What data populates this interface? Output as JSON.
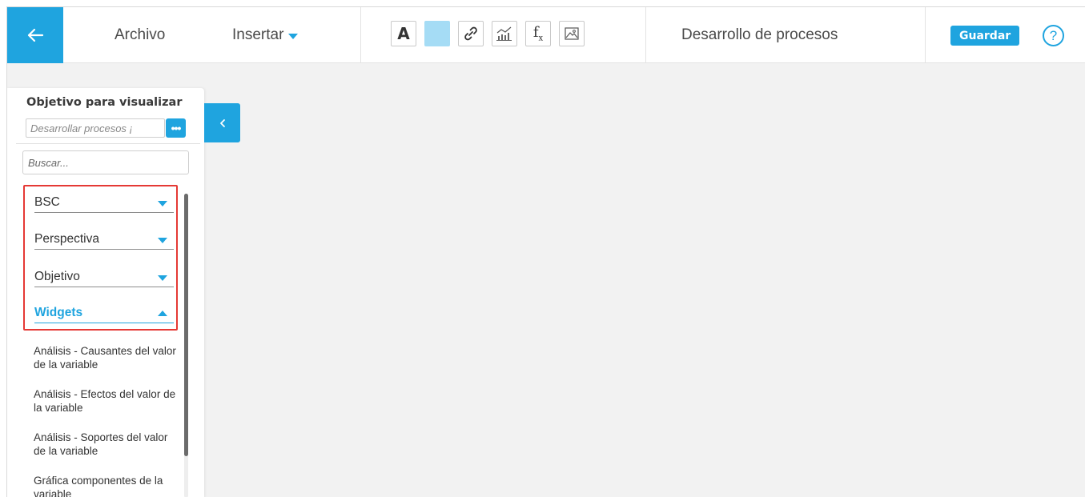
{
  "topbar": {
    "menu": {
      "file": "Archivo",
      "insert": "Insertar"
    },
    "tools": [
      "text-tool",
      "fill-color-tool",
      "link-tool",
      "chart-tool",
      "formula-tool",
      "image-tool"
    ],
    "fx_label": "f",
    "fx_sub": "x",
    "text_tool_label": "A",
    "document_title": "Desarrollo de procesos",
    "save_label": "Guardar",
    "help_label": "?"
  },
  "panel": {
    "title": "Objetivo para visualizar",
    "objective_value": "Desarrollar procesos ¡",
    "dots_label": "•••",
    "search_placeholder": "Buscar...",
    "categories": [
      {
        "label": "BSC",
        "open": false
      },
      {
        "label": "Perspectiva",
        "open": false
      },
      {
        "label": "Objetivo",
        "open": false
      },
      {
        "label": "Widgets",
        "open": true
      }
    ],
    "widgets": [
      "Análisis - Causantes del valor de la variable",
      "Análisis - Efectos del valor de la variable",
      "Análisis - Soportes del valor de la variable",
      "Gráfica componentes de la variable"
    ]
  },
  "colors": {
    "accent": "#1fa4df",
    "highlight_box": "#e53935",
    "fill_swatch": "#a5dcf5"
  }
}
